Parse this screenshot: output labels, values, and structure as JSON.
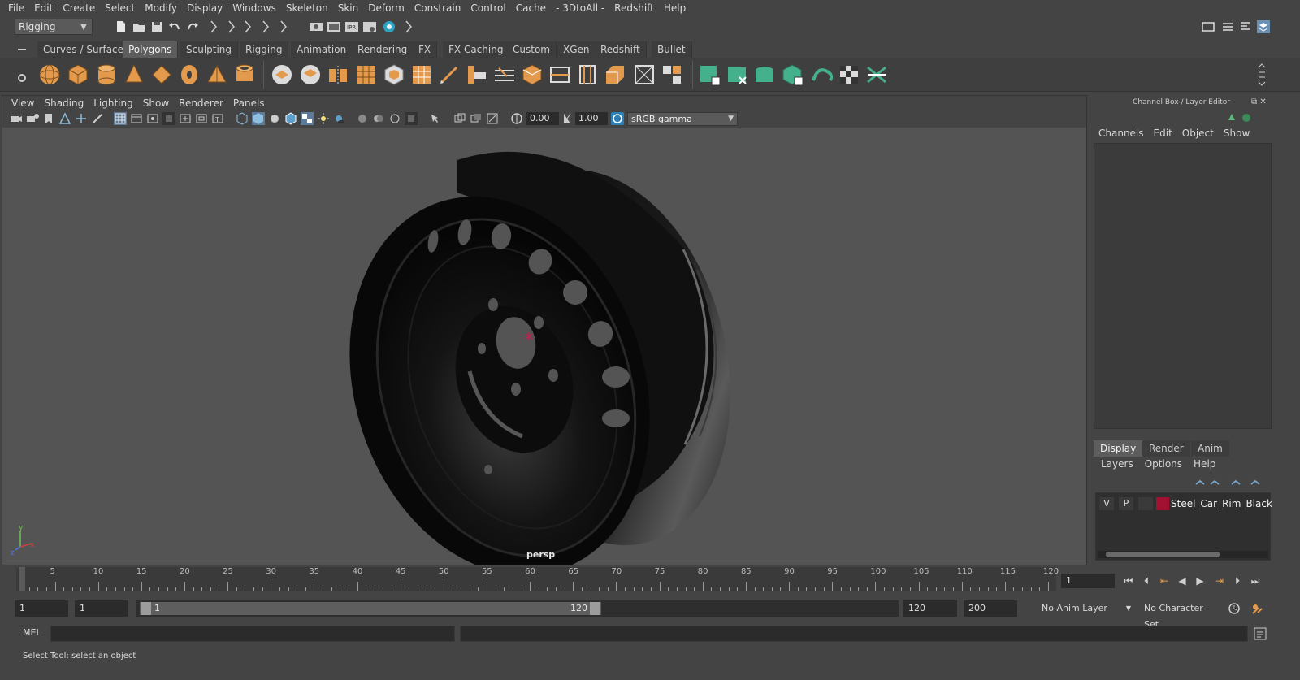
{
  "menubar": [
    "File",
    "Edit",
    "Create",
    "Select",
    "Modify",
    "Display",
    "Windows",
    "Skeleton",
    "Skin",
    "Deform",
    "Constrain",
    "Control",
    "Cache",
    "- 3DtoAll -",
    "Redshift",
    "Help"
  ],
  "status_line": {
    "mode": "Rigging"
  },
  "shelf_tabs": [
    "Curves / Surfaces",
    "Polygons",
    "Sculpting",
    "Rigging",
    "Animation",
    "Rendering",
    "FX",
    "FX Caching",
    "Custom",
    "XGen",
    "Redshift",
    "Bullet"
  ],
  "shelf_active": "Polygons",
  "viewport": {
    "menu": [
      "View",
      "Shading",
      "Lighting",
      "Show",
      "Renderer",
      "Panels"
    ],
    "exposure": "0.00",
    "gamma": "1.00",
    "color_space": "sRGB gamma",
    "camera": "persp"
  },
  "channel_box": {
    "title": "Channel Box / Layer Editor",
    "menu": [
      "Channels",
      "Edit",
      "Object",
      "Show"
    ]
  },
  "layer_editor": {
    "tabs": [
      "Display",
      "Render",
      "Anim"
    ],
    "active_tab": "Display",
    "menu": [
      "Layers",
      "Options",
      "Help"
    ],
    "layers": [
      {
        "visible": "V",
        "playback": "P",
        "name": "Steel_Car_Rim_Black",
        "color": "#a21132"
      }
    ]
  },
  "time_slider": {
    "ticks": [
      "5",
      "10",
      "15",
      "20",
      "25",
      "30",
      "35",
      "40",
      "45",
      "50",
      "55",
      "60",
      "65",
      "70",
      "75",
      "80",
      "85",
      "90",
      "95",
      "100",
      "105",
      "110",
      "115",
      "120"
    ],
    "start_label": "1",
    "current_frame": "1"
  },
  "range_slider": {
    "start_time": "1",
    "playback_start": "1",
    "range_start_label": "1",
    "range_end_label": "120",
    "playback_end": "120",
    "end_time": "200",
    "anim_layer": "No Anim Layer",
    "character_set": "No Character Set"
  },
  "command_line": {
    "label": "MEL"
  },
  "help_line": "Select Tool: select an object"
}
